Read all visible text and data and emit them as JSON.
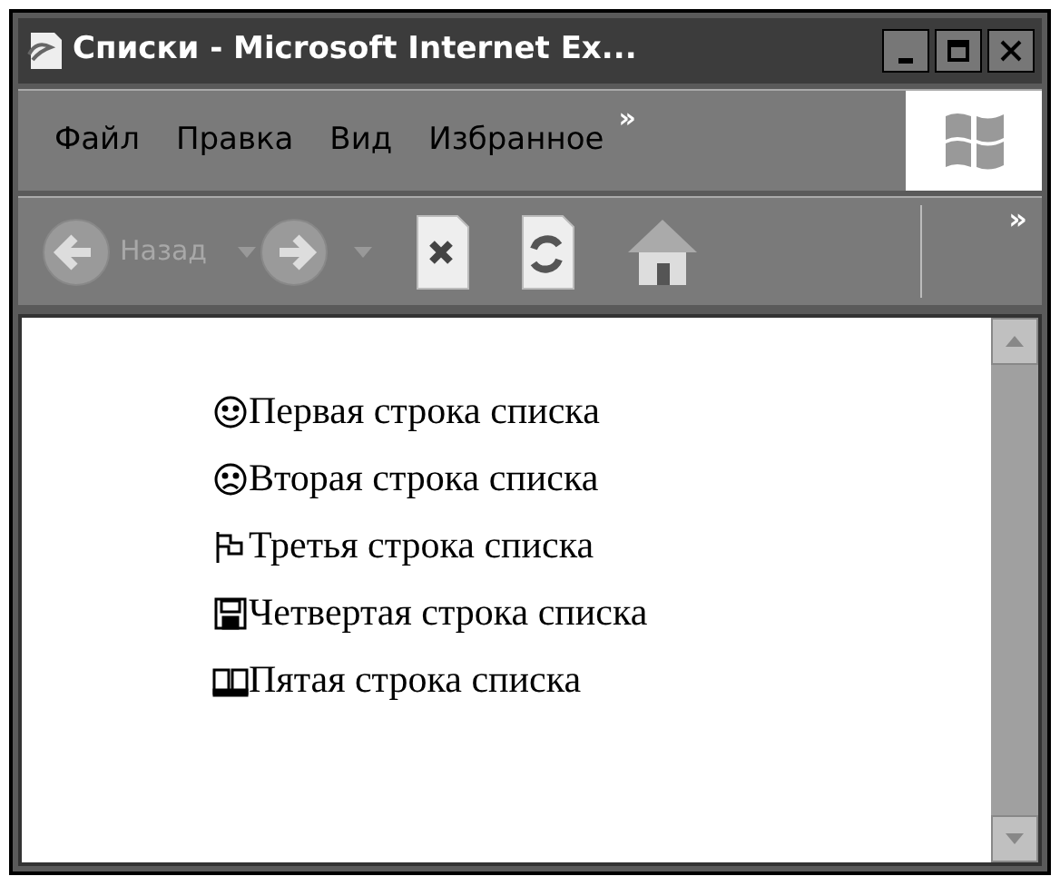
{
  "window": {
    "title": "Списки - Microsoft Internet Ex..."
  },
  "menu": [
    "Файл",
    "Правка",
    "Вид",
    "Избранное",
    "»"
  ],
  "toolbar": [
    {
      "kind": "back",
      "label": "Назад"
    },
    {
      "kind": "forward"
    },
    {
      "kind": "stop"
    },
    {
      "kind": "refresh"
    },
    {
      "kind": "home"
    },
    {
      "kind": "more",
      "label": "»"
    }
  ],
  "list": [
    {
      "kind": "smile",
      "text": "Первая строка списка"
    },
    {
      "kind": "frown",
      "text": "Вторая строка списка"
    },
    {
      "kind": "flag",
      "text": "Третья строка списка"
    },
    {
      "kind": "floppy",
      "text": "Четвертая строка списка"
    },
    {
      "kind": "book",
      "text": "Пятая строка списка"
    }
  ]
}
